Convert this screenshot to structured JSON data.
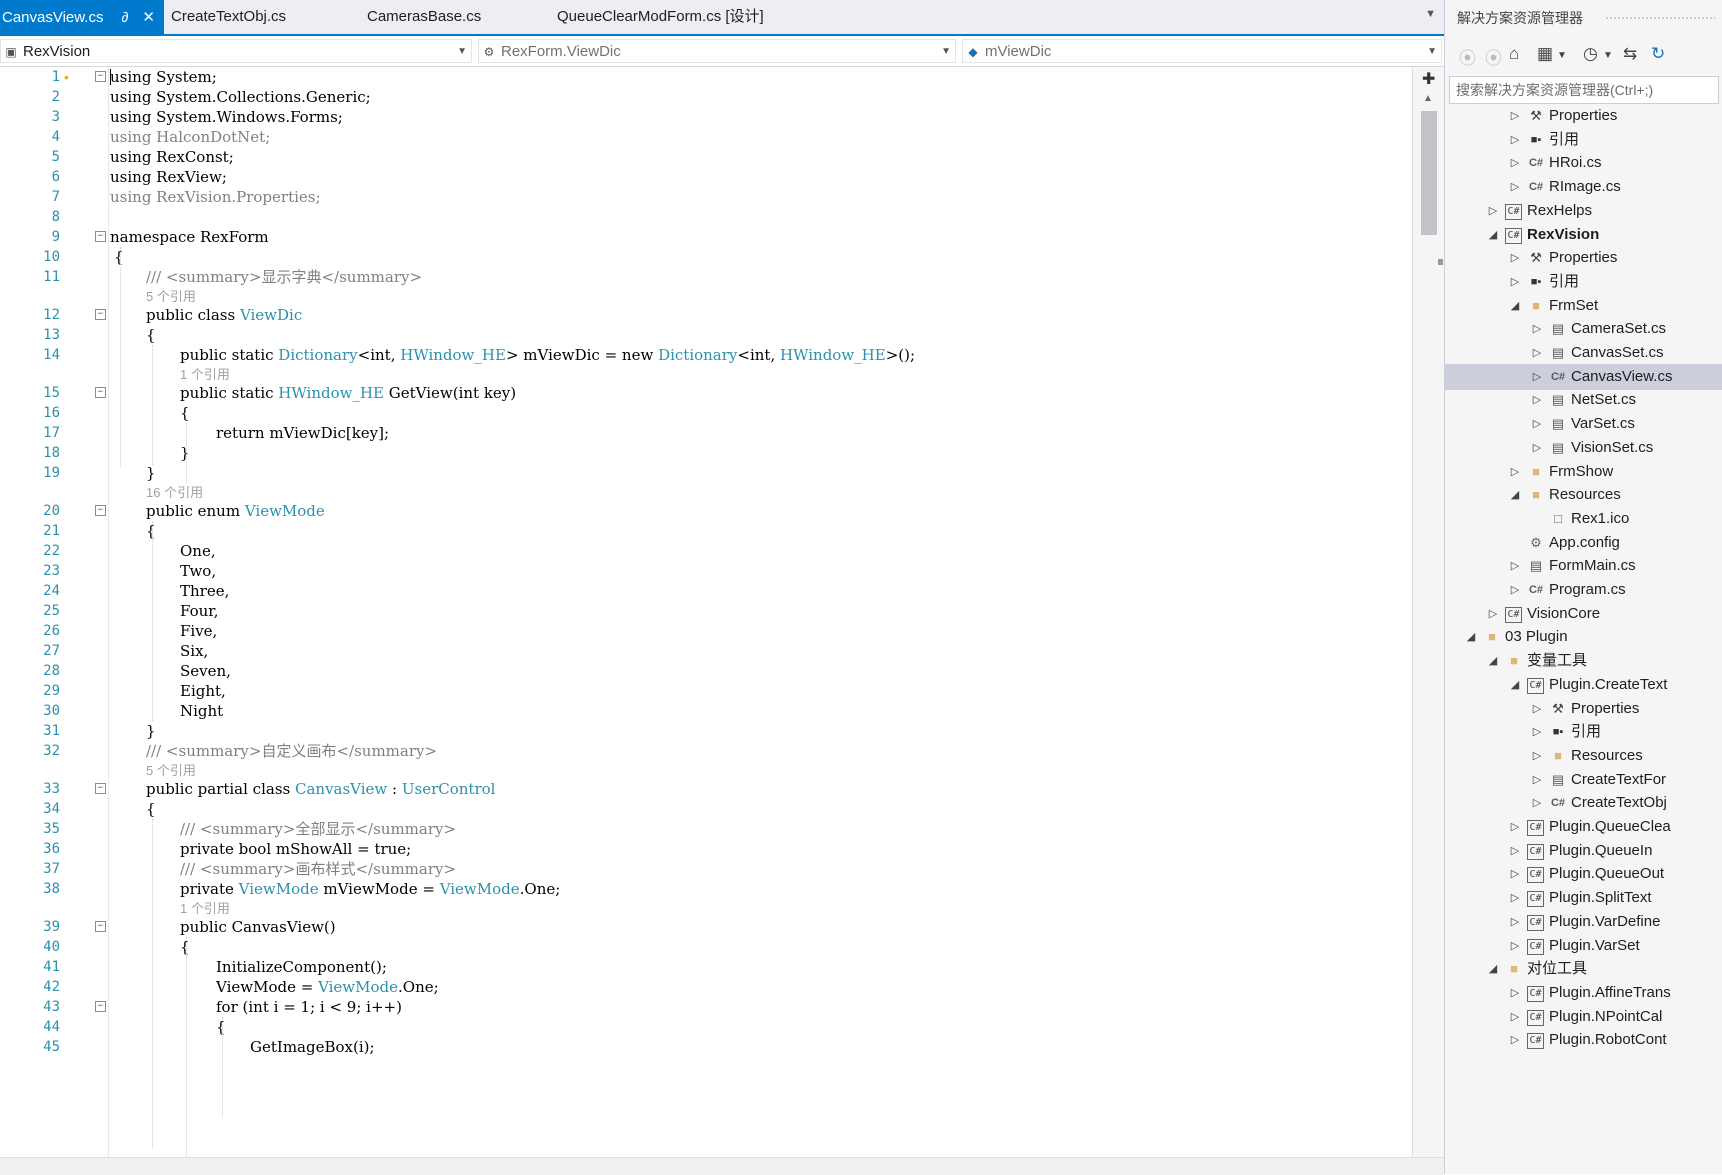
{
  "tabs": [
    {
      "label": "CanvasView.cs",
      "active": true,
      "pin": "∂",
      "close": "✕"
    },
    {
      "label": "CreateTextObj.cs"
    },
    {
      "label": "CamerasBase.cs"
    },
    {
      "label": "QueueClearModForm.cs [设计]"
    }
  ],
  "nav": {
    "project": "RexVision",
    "type": "RexForm.ViewDic",
    "member": "mViewDic"
  },
  "code_lines": [
    {
      "n": "1",
      "text": "using System;"
    },
    {
      "n": "2",
      "text": "using System.Collections.Generic;"
    },
    {
      "n": "3",
      "text": "using System.Windows.Forms;"
    },
    {
      "n": "4",
      "text": "using HalconDotNet;"
    },
    {
      "n": "5",
      "text": "using RexConst;"
    },
    {
      "n": "6",
      "text": "using RexView;"
    },
    {
      "n": "7",
      "text": "using RexVision.Properties;"
    },
    {
      "n": "8",
      "text": ""
    },
    {
      "n": "9",
      "text": "namespace RexForm"
    },
    {
      "n": "10",
      "text": "{"
    },
    {
      "n": "11",
      "text": "/// <summary>显示字典</summary>"
    },
    {
      "ref": "5 个引用"
    },
    {
      "n": "12",
      "text_a": "public class ",
      "text_b": "ViewDic"
    },
    {
      "n": "13",
      "text": "{"
    },
    {
      "n": "14",
      "text_a": "public static ",
      "text_b": "Dictionary",
      "text_c": "<int, ",
      "text_d": "HWindow_HE",
      "text_e": "> mViewDic = new ",
      "text_f": "Dictionary",
      "text_g": "<int, ",
      "text_h": "HWindow_HE",
      "text_i": ">();"
    },
    {
      "ref": "1 个引用"
    },
    {
      "n": "15",
      "text_a": "public static ",
      "text_b": "HWindow_HE",
      "text_c": " GetView(int key)"
    },
    {
      "n": "16",
      "text": "{"
    },
    {
      "n": "17",
      "text": "return mViewDic[key];"
    },
    {
      "n": "18",
      "text": "}"
    },
    {
      "n": "19",
      "text": "}"
    },
    {
      "ref": "16 个引用"
    },
    {
      "n": "20",
      "text_a": "public enum ",
      "text_b": "ViewMode"
    },
    {
      "n": "21",
      "text": "{"
    },
    {
      "n": "22",
      "text": "One,"
    },
    {
      "n": "23",
      "text": "Two,"
    },
    {
      "n": "24",
      "text": "Three,"
    },
    {
      "n": "25",
      "text": "Four,"
    },
    {
      "n": "26",
      "text": "Five,"
    },
    {
      "n": "27",
      "text": "Six,"
    },
    {
      "n": "28",
      "text": "Seven,"
    },
    {
      "n": "29",
      "text": "Eight,"
    },
    {
      "n": "30",
      "text": "Night"
    },
    {
      "n": "31",
      "text": "}"
    },
    {
      "n": "32",
      "text": "/// <summary>自定义画布</summary>"
    },
    {
      "ref": "5 个引用"
    },
    {
      "n": "33",
      "text_a": "public partial class ",
      "text_b": "CanvasView",
      "text_c": " : ",
      "text_d": "UserControl"
    },
    {
      "n": "34",
      "text": "{"
    },
    {
      "n": "35",
      "text": "/// <summary>全部显示</summary>"
    },
    {
      "n": "36",
      "text": "private bool mShowAll = true;"
    },
    {
      "n": "37",
      "text": "/// <summary>画布样式</summary>"
    },
    {
      "n": "38",
      "text_a": "private ",
      "text_b": "ViewMode",
      "text_c": " mViewMode = ",
      "text_d": "ViewMode",
      "text_e": ".One;"
    },
    {
      "ref": "1 个引用"
    },
    {
      "n": "39",
      "text": "public CanvasView()"
    },
    {
      "n": "40",
      "text": "{"
    },
    {
      "n": "41",
      "text": "InitializeComponent();"
    },
    {
      "n": "42",
      "text_a": "ViewMode = ",
      "text_b": "ViewMode",
      "text_c": ".One;"
    },
    {
      "n": "43",
      "text": "for (int i = 1; i < 9; i++)"
    },
    {
      "n": "44",
      "text": "{"
    },
    {
      "n": "45",
      "text": "GetImageBox(i);"
    }
  ],
  "explorer": {
    "title": "解决方案资源管理器",
    "search_placeholder": "搜索解决方案资源管理器(Ctrl+;)",
    "toolbar_icons": [
      "back-icon",
      "forward-icon",
      "home-icon",
      "switch-views-icon",
      "dropdown-icon",
      "pending-changes-icon",
      "dropdown-icon",
      "sync-icon",
      "refresh-icon"
    ],
    "nodes": [
      {
        "label": "Properties",
        "icon": "wrench",
        "depth": 3,
        "exp": "▷"
      },
      {
        "label": "引用",
        "icon": "refs",
        "depth": 3,
        "exp": "▷"
      },
      {
        "label": "HRoi.cs",
        "icon": "cs",
        "depth": 3,
        "exp": "▷"
      },
      {
        "label": "RImage.cs",
        "icon": "cs",
        "depth": 3,
        "exp": "▷"
      },
      {
        "label": "RexHelps",
        "icon": "proj",
        "depth": 2,
        "exp": "▷"
      },
      {
        "label": "RexVision",
        "icon": "proj",
        "depth": 2,
        "exp": "◢",
        "bold": true
      },
      {
        "label": "Properties",
        "icon": "wrench",
        "depth": 3,
        "exp": "▷"
      },
      {
        "label": "引用",
        "icon": "refs",
        "depth": 3,
        "exp": "▷"
      },
      {
        "label": "FrmSet",
        "icon": "folder-open",
        "depth": 3,
        "exp": "◢"
      },
      {
        "label": "CameraSet.cs",
        "icon": "form",
        "depth": 4,
        "exp": "▷"
      },
      {
        "label": "CanvasSet.cs",
        "icon": "form",
        "depth": 4,
        "exp": "▷"
      },
      {
        "label": "CanvasView.cs",
        "icon": "cs",
        "depth": 4,
        "exp": "▷",
        "selected": true
      },
      {
        "label": "NetSet.cs",
        "icon": "form",
        "depth": 4,
        "exp": "▷"
      },
      {
        "label": "VarSet.cs",
        "icon": "form",
        "depth": 4,
        "exp": "▷"
      },
      {
        "label": "VisionSet.cs",
        "icon": "form",
        "depth": 4,
        "exp": "▷"
      },
      {
        "label": "FrmShow",
        "icon": "folder",
        "depth": 3,
        "exp": "▷"
      },
      {
        "label": "Resources",
        "icon": "folder-open",
        "depth": 3,
        "exp": "◢"
      },
      {
        "label": "Rex1.ico",
        "icon": "file",
        "depth": 4,
        "exp": ""
      },
      {
        "label": "App.config",
        "icon": "config",
        "depth": 3,
        "exp": ""
      },
      {
        "label": "FormMain.cs",
        "icon": "form",
        "depth": 3,
        "exp": "▷"
      },
      {
        "label": "Program.cs",
        "icon": "cs",
        "depth": 3,
        "exp": "▷"
      },
      {
        "label": "VisionCore",
        "icon": "proj",
        "depth": 2,
        "exp": "▷"
      },
      {
        "label": "03 Plugin",
        "icon": "folder-open",
        "depth": 1,
        "exp": "◢"
      },
      {
        "label": "变量工具",
        "icon": "folder-open",
        "depth": 2,
        "exp": "◢"
      },
      {
        "label": "Plugin.CreateText",
        "icon": "proj",
        "depth": 3,
        "exp": "◢"
      },
      {
        "label": "Properties",
        "icon": "wrench",
        "depth": 4,
        "exp": "▷"
      },
      {
        "label": "引用",
        "icon": "refs",
        "depth": 4,
        "exp": "▷"
      },
      {
        "label": "Resources",
        "icon": "folder",
        "depth": 4,
        "exp": "▷"
      },
      {
        "label": "CreateTextFor",
        "icon": "form",
        "depth": 4,
        "exp": "▷"
      },
      {
        "label": "CreateTextObj",
        "icon": "cs",
        "depth": 4,
        "exp": "▷"
      },
      {
        "label": "Plugin.QueueClea",
        "icon": "proj",
        "depth": 3,
        "exp": "▷"
      },
      {
        "label": "Plugin.QueueIn",
        "icon": "proj",
        "depth": 3,
        "exp": "▷"
      },
      {
        "label": "Plugin.QueueOut",
        "icon": "proj",
        "depth": 3,
        "exp": "▷"
      },
      {
        "label": "Plugin.SplitText",
        "icon": "proj",
        "depth": 3,
        "exp": "▷"
      },
      {
        "label": "Plugin.VarDefine",
        "icon": "proj",
        "depth": 3,
        "exp": "▷"
      },
      {
        "label": "Plugin.VarSet",
        "icon": "proj",
        "depth": 3,
        "exp": "▷"
      },
      {
        "label": "对位工具",
        "icon": "folder-open",
        "depth": 2,
        "exp": "◢"
      },
      {
        "label": "Plugin.AffineTrans",
        "icon": "proj",
        "depth": 3,
        "exp": "▷"
      },
      {
        "label": "Plugin.NPointCal",
        "icon": "proj",
        "depth": 3,
        "exp": "▷"
      },
      {
        "label": "Plugin.RobotCont",
        "icon": "proj",
        "depth": 3,
        "exp": "▷"
      }
    ]
  },
  "colors": {
    "accent": "#007acc",
    "type_name": "#2b91af",
    "comment": "#808080",
    "line_number": "#2b91af",
    "selected_row": "#cccedb"
  }
}
